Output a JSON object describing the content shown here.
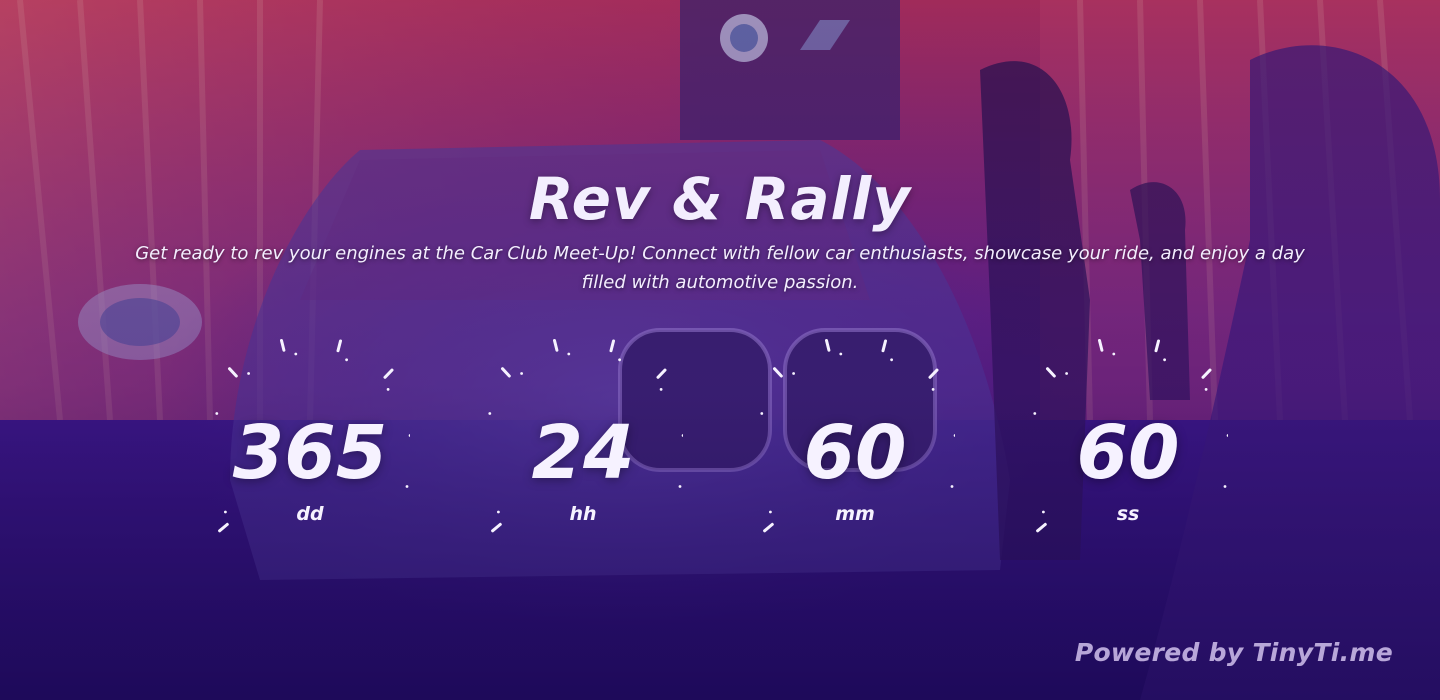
{
  "event": {
    "title": "Rev & Rally",
    "tagline": "Get ready to rev your engines at the Car Club Meet-Up! Connect with fellow car enthusiasts, showcase your ride, and enjoy a day filled with automotive passion."
  },
  "countdown": [
    {
      "value": "365",
      "label": "dd"
    },
    {
      "value": "24",
      "label": "hh"
    },
    {
      "value": "60",
      "label": "mm"
    },
    {
      "value": "60",
      "label": "ss"
    }
  ],
  "footer": {
    "powered_by": "Powered by TinyTi.me"
  },
  "colors": {
    "accent": "#f6f2ff",
    "background": "#2a0f5c",
    "stage_red": "#d8384f"
  }
}
